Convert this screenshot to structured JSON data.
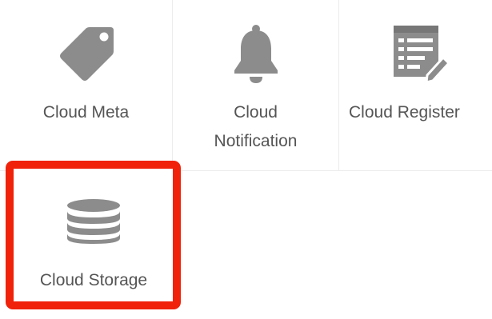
{
  "tiles": [
    {
      "label": "Cloud Meta",
      "icon": "tag-icon"
    },
    {
      "label_line1": "Cloud",
      "label_line2": "Notification",
      "icon": "bell-icon"
    },
    {
      "label": "Cloud Register",
      "icon": "register-form-icon"
    },
    {
      "label": "Cloud Storage",
      "icon": "database-icon",
      "selected": true
    }
  ],
  "colors": {
    "icon": "#8c8c8c",
    "label": "#555555",
    "highlight": "#f0220a",
    "divider": "#ececec"
  }
}
